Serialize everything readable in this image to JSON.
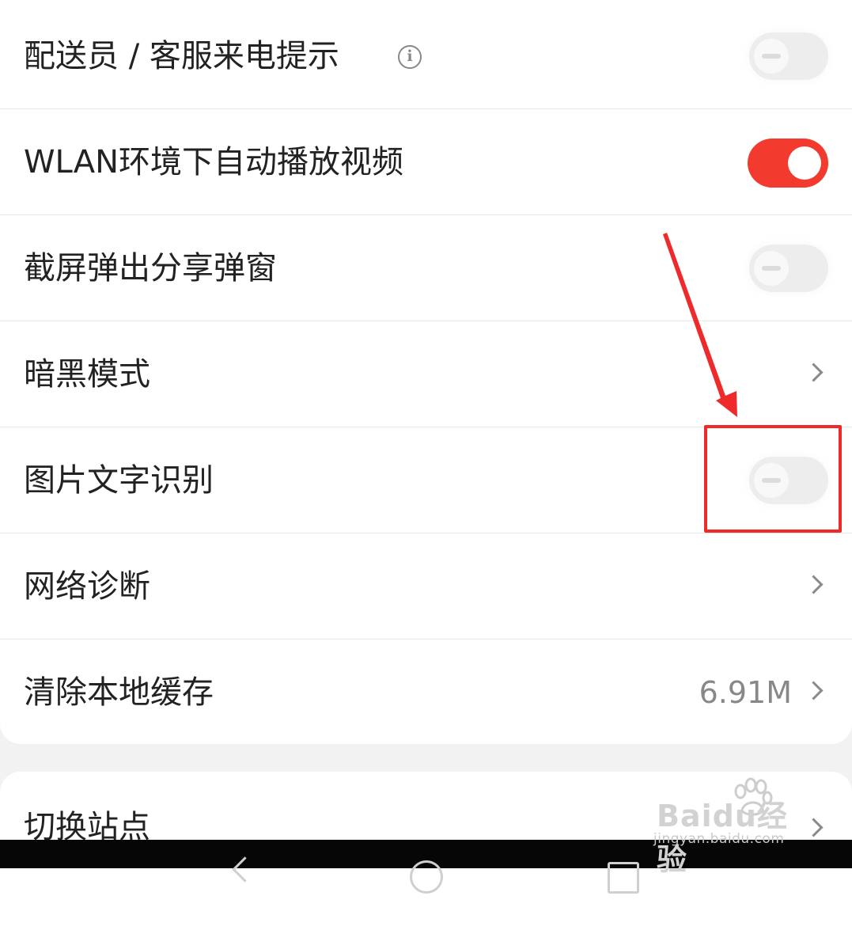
{
  "settings_card": {
    "rows": [
      {
        "label": "配送员 / 客服来电提示",
        "control": "toggle",
        "on": false,
        "has_info_icon": true
      },
      {
        "label": "WLAN环境下自动播放视频",
        "control": "toggle",
        "on": true
      },
      {
        "label": "截屏弹出分享弹窗",
        "control": "toggle",
        "on": false
      },
      {
        "label": "暗黑模式",
        "control": "chevron"
      },
      {
        "label": "图片文字识别",
        "control": "toggle",
        "on": false
      },
      {
        "label": "网络诊断",
        "control": "chevron"
      },
      {
        "label": "清除本地缓存",
        "control": "chevron",
        "value": "6.91M"
      }
    ]
  },
  "second_card": {
    "rows": [
      {
        "label": "切换站点",
        "control": "chevron"
      }
    ]
  },
  "colors": {
    "accent_red": "#f23a2e",
    "annotation_red": "#ee2a2a",
    "background": "#f2f2f2",
    "card": "#ffffff"
  },
  "icons": {
    "info": "info-icon",
    "chevron": "chevron-right-icon"
  },
  "watermark": {
    "brand": "Baidu经验",
    "url": "jingyan.baidu.com"
  }
}
